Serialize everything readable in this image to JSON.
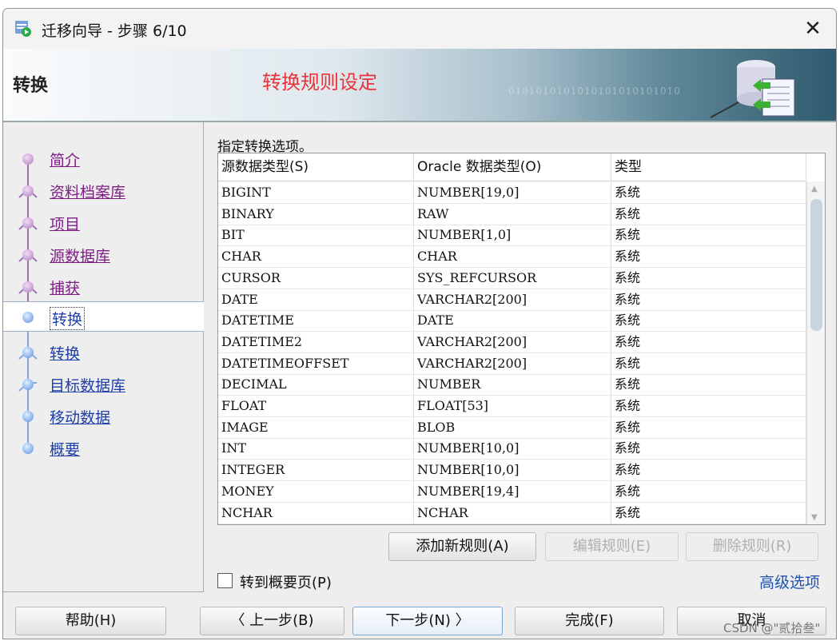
{
  "window": {
    "title": "迁移向导 - 步骤 6/10",
    "close_icon": "close-icon"
  },
  "banner": {
    "heading": "转换",
    "subtitle": "转换规则设定",
    "binary_text": "0101010101010101010101010"
  },
  "nav": {
    "items": [
      {
        "label": "简介",
        "state": "visited"
      },
      {
        "label": "资料档案库",
        "state": "visited"
      },
      {
        "label": "项目",
        "state": "visited"
      },
      {
        "label": "源数据库",
        "state": "visited"
      },
      {
        "label": "捕获",
        "state": "visited"
      },
      {
        "label": "转换",
        "state": "current"
      },
      {
        "label": "转换",
        "state": "future"
      },
      {
        "label": "目标数据库",
        "state": "future"
      },
      {
        "label": "移动数据",
        "state": "future"
      },
      {
        "label": "概要",
        "state": "future"
      }
    ]
  },
  "main": {
    "instruction": "指定转换选项。",
    "columns": [
      "源数据类型(S)",
      "Oracle 数据类型(O)",
      "类型"
    ],
    "rows": [
      [
        "BIGINT",
        "NUMBER[19,0]",
        "系统"
      ],
      [
        "BINARY",
        "RAW",
        "系统"
      ],
      [
        "BIT",
        "NUMBER[1,0]",
        "系统"
      ],
      [
        "CHAR",
        "CHAR",
        "系统"
      ],
      [
        "CURSOR",
        "SYS_REFCURSOR",
        "系统"
      ],
      [
        "DATE",
        "VARCHAR2[200]",
        "系统"
      ],
      [
        "DATETIME",
        "DATE",
        "系统"
      ],
      [
        "DATETIME2",
        "VARCHAR2[200]",
        "系统"
      ],
      [
        "DATETIMEOFFSET",
        "VARCHAR2[200]",
        "系统"
      ],
      [
        "DECIMAL",
        "NUMBER",
        "系统"
      ],
      [
        "FLOAT",
        "FLOAT[53]",
        "系统"
      ],
      [
        "IMAGE",
        "BLOB",
        "系统"
      ],
      [
        "INT",
        "NUMBER[10,0]",
        "系统"
      ],
      [
        "INTEGER",
        "NUMBER[10,0]",
        "系统"
      ],
      [
        "MONEY",
        "NUMBER[19,4]",
        "系统"
      ],
      [
        "NCHAR",
        "NCHAR",
        "系统"
      ]
    ],
    "add_rule": "添加新规则(A)",
    "edit_rule": "编辑规则(E)",
    "delete_rule": "删除规则(R)",
    "goto_summary": "转到概要页(P)",
    "advanced": "高级选项"
  },
  "footer": {
    "help": "帮助(H)",
    "back": "〈 上一步(B)",
    "next": "下一步(N) 〉",
    "finish": "完成(F)",
    "cancel": "取消"
  },
  "watermark": "CSDN @\"贰拾叁\"",
  "colors": {
    "visited": "#7d1f85",
    "link": "#1e3ea8",
    "subtitle": "#e8333a"
  }
}
